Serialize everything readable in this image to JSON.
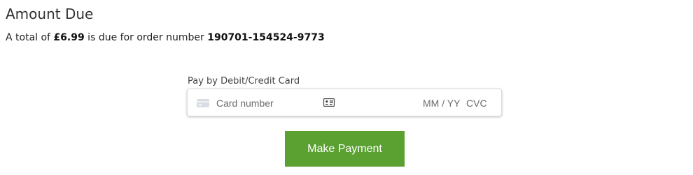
{
  "header": {
    "title": "Amount Due"
  },
  "summary": {
    "prefix": "A total of ",
    "amount": "£6.99",
    "middle": " is due for order number ",
    "order_number": "190701-154524-9773"
  },
  "payment": {
    "label": "Pay by Debit/Credit Card",
    "card_number_placeholder": "Card number",
    "expiry_placeholder": "MM / YY",
    "cvc_placeholder": "CVC",
    "button_label": "Make Payment"
  },
  "colors": {
    "button_bg": "#5aa132",
    "button_text": "#ffffff",
    "text": "#333333"
  },
  "icons": {
    "card_brand": "generic-card-icon",
    "autofill": "contact-card-icon"
  }
}
